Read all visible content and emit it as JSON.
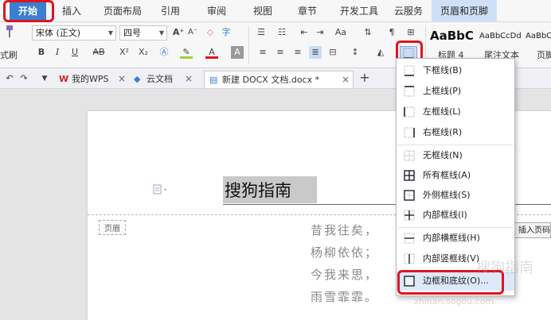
{
  "menu": {
    "tabs": [
      "开始",
      "插入",
      "页面布局",
      "引用",
      "审阅",
      "视图",
      "章节",
      "开发工具",
      "云服务"
    ],
    "context_tab": "页眉和页脚",
    "active_tab": "开始",
    "accent_color": "#3b7fd1",
    "highlight_color": "#e0141e"
  },
  "ribbon": {
    "format_painter_label": "式刷",
    "font_name": "宋体 (正文)",
    "font_size": "四号",
    "grow_font": "A⁺",
    "shrink_font": "A⁻",
    "bold": "B",
    "italic": "I",
    "underline": "U",
    "strike": "AB",
    "superscript": "X²",
    "subscript": "X₂",
    "font_color": "A",
    "styles": [
      {
        "sample": "AaBbC",
        "name": "标题 4"
      },
      {
        "sample": "AaBbCcDd",
        "name": "尾注文本"
      },
      {
        "sample": "AaBbC",
        "name": "页脚"
      }
    ]
  },
  "tabs": {
    "mywps": "我的WPS",
    "cloud": "云文档",
    "document": "新建 DOCX 文档.docx *",
    "new_tab": "+"
  },
  "document": {
    "header_title": "搜狗指南",
    "header_label": "页眉",
    "insert_page_label": "插入页码",
    "poem": [
      "昔我往矣，",
      "杨柳依依；",
      "今我来思，",
      "雨雪霏霏。"
    ]
  },
  "border_menu": {
    "items": [
      {
        "label": "下框线(B)",
        "icon": "border-bottom-icon"
      },
      {
        "label": "上框线(P)",
        "icon": "border-top-icon"
      },
      {
        "label": "左框线(L)",
        "icon": "border-left-icon"
      },
      {
        "label": "右框线(R)",
        "icon": "border-right-icon"
      },
      {
        "label": "无框线(N)",
        "icon": "border-none-icon"
      },
      {
        "label": "所有框线(A)",
        "icon": "border-all-icon"
      },
      {
        "label": "外侧框线(S)",
        "icon": "border-outside-icon"
      },
      {
        "label": "内部框线(I)",
        "icon": "border-inside-icon"
      },
      {
        "label": "内部横框线(H)",
        "icon": "border-inside-horizontal-icon"
      },
      {
        "label": "内部竖框线(V)",
        "icon": "border-inside-vertical-icon"
      },
      {
        "label": "边框和底纹(O)...",
        "icon": "borders-shading-icon"
      }
    ]
  },
  "watermark": {
    "line1": "搜狗指南",
    "line2": "zhinan.sogou.com"
  }
}
